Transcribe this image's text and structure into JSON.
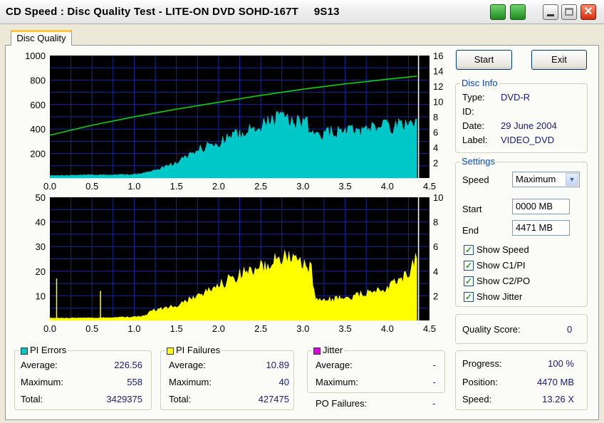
{
  "window": {
    "title": "CD Speed : Disc Quality Test - LITE-ON DVD SOHD-167T     9S13"
  },
  "tab": {
    "label": "Disc Quality"
  },
  "chart_data": [
    {
      "type": "area",
      "left_axis": {
        "ticks": [
          "1000",
          "800",
          "600",
          "400",
          "200"
        ],
        "ylim": [
          0,
          1000
        ]
      },
      "right_axis": {
        "ticks": [
          "16",
          "14",
          "12",
          "10",
          "8",
          "6",
          "4",
          "2"
        ],
        "ylim": [
          0,
          16
        ]
      },
      "x_ticks": [
        "0.0",
        "0.5",
        "1.0",
        "1.5",
        "2.0",
        "2.5",
        "3.0",
        "3.5",
        "4.0",
        "4.5"
      ],
      "xlim": [
        0,
        4.5
      ],
      "grid": true,
      "series": [
        {
          "color": "#00c8c8",
          "axis": "left",
          "x": [
            0.0,
            0.5,
            1.0,
            1.2,
            1.4,
            1.5,
            1.65,
            1.75,
            2.0,
            2.2,
            2.5,
            2.75,
            2.9,
            3.05,
            3.1,
            3.15,
            3.5,
            4.0,
            4.3,
            4.35
          ],
          "y": [
            20,
            25,
            30,
            50,
            100,
            130,
            190,
            230,
            290,
            360,
            430,
            490,
            470,
            460,
            340,
            360,
            380,
            420,
            450,
            480
          ]
        },
        {
          "color": "#00e000",
          "axis": "right",
          "x": [
            0.0,
            0.5,
            1.0,
            1.5,
            2.0,
            2.5,
            3.0,
            3.5,
            4.0,
            4.35
          ],
          "y": [
            5.6,
            6.9,
            8.0,
            9.0,
            9.9,
            10.8,
            11.6,
            12.3,
            12.9,
            13.3
          ]
        }
      ],
      "markers": [
        {
          "x": 1.68,
          "y": 200
        }
      ],
      "end_x": 4.37
    },
    {
      "type": "area",
      "left_axis": {
        "ticks": [
          "50",
          "40",
          "30",
          "20",
          "10"
        ],
        "ylim": [
          0,
          50
        ]
      },
      "right_axis": {
        "ticks": [
          "10",
          "8",
          "6",
          "4",
          "2"
        ],
        "ylim": [
          0,
          10
        ]
      },
      "x_ticks": [
        "0.0",
        "0.5",
        "1.0",
        "1.5",
        "2.0",
        "2.5",
        "3.0",
        "3.5",
        "4.0",
        "4.5"
      ],
      "xlim": [
        0,
        4.5
      ],
      "grid": true,
      "series": [
        {
          "color": "#ffff00",
          "axis": "left",
          "x": [
            0.0,
            0.5,
            1.0,
            1.15,
            1.2,
            1.5,
            1.75,
            2.0,
            2.2,
            2.5,
            2.75,
            2.9,
            3.05,
            3.1,
            3.15,
            3.5,
            4.0,
            4.2,
            4.35
          ],
          "y": [
            1,
            1,
            1.5,
            2,
            4,
            6,
            10,
            14,
            18,
            22,
            26,
            24,
            23,
            21,
            8,
            9,
            13,
            18,
            25
          ]
        }
      ],
      "markers": [
        {
          "x": 0.08,
          "y": 17
        },
        {
          "x": 0.6,
          "y": 12
        }
      ],
      "end_x": 4.37
    }
  ],
  "buttons": {
    "start": "Start",
    "exit": "Exit"
  },
  "disc_info": {
    "title": "Disc Info",
    "type_label": "Type:",
    "type_value": "DVD-R",
    "id_label": "ID:",
    "id_value": "",
    "date_label": "Date:",
    "date_value": "29 June 2004",
    "label_label": "Label:",
    "label_value": "VIDEO_DVD"
  },
  "settings": {
    "title": "Settings",
    "speed_label": "Speed",
    "speed_value": "Maximum",
    "start_label": "Start",
    "start_value": "0000 MB",
    "end_label": "End",
    "end_value": "4471 MB",
    "checks": [
      "Show Speed",
      "Show C1/PI",
      "Show C2/PO",
      "Show Jitter"
    ]
  },
  "quality": {
    "label": "Quality Score:",
    "value": "0"
  },
  "progress": {
    "progress_label": "Progress:",
    "progress_value": "100 %",
    "position_label": "Position:",
    "position_value": "4470 MB",
    "speed_label": "Speed:",
    "speed_value": "13.26 X"
  },
  "pi_errors": {
    "title": "PI Errors",
    "color": "#00c8c8",
    "average_label": "Average:",
    "average": "226.56",
    "maximum_label": "Maximum:",
    "maximum": "558",
    "total_label": "Total:",
    "total": "3429375"
  },
  "pi_failures": {
    "title": "PI Failures",
    "color": "#ffff00",
    "average_label": "Average:",
    "average": "10.89",
    "maximum_label": "Maximum:",
    "maximum": "40",
    "total_label": "Total:",
    "total": "427475"
  },
  "jitter": {
    "title": "Jitter",
    "color": "#e000e0",
    "average_label": "Average:",
    "average": "-",
    "maximum_label": "Maximum:",
    "maximum": "-",
    "po_label": "PO Failures:",
    "po_value": "-"
  }
}
